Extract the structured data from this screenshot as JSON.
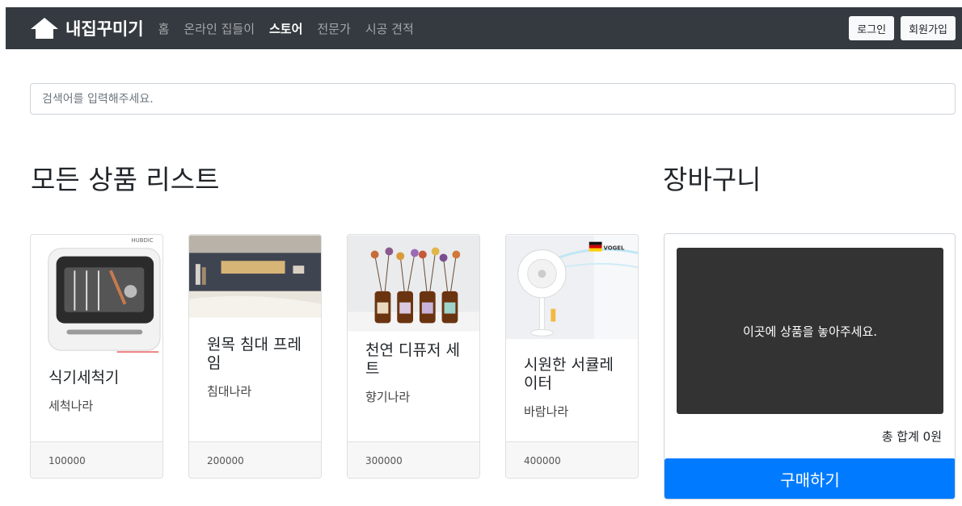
{
  "navbar": {
    "brand": "내집꾸미기",
    "links": [
      "홈",
      "온라인 집들이",
      "스토어",
      "전문가",
      "시공 견적"
    ],
    "login_label": "로그인",
    "signup_label": "회원가입"
  },
  "search": {
    "placeholder": "검색어를 입력해주세요.",
    "value": ""
  },
  "products_heading": "모든 상품 리스트",
  "products": [
    {
      "title": "식기세척기",
      "seller": "세척나라",
      "price": "100000",
      "badge": "HUBDIC"
    },
    {
      "title": "원목 침대 프레임",
      "seller": "침대나라",
      "price": "200000"
    },
    {
      "title": "천연 디퓨저 세트",
      "seller": "향기나라",
      "price": "300000"
    },
    {
      "title": "시원한 서큘레이터",
      "seller": "바람나라",
      "price": "400000",
      "badge": "VOGEL"
    }
  ],
  "cart": {
    "heading": "장바구니",
    "dropzone_text": "이곳에 상품을 놓아주세요.",
    "total_text": "총 합계 0원",
    "buy_label": "구매하기"
  }
}
